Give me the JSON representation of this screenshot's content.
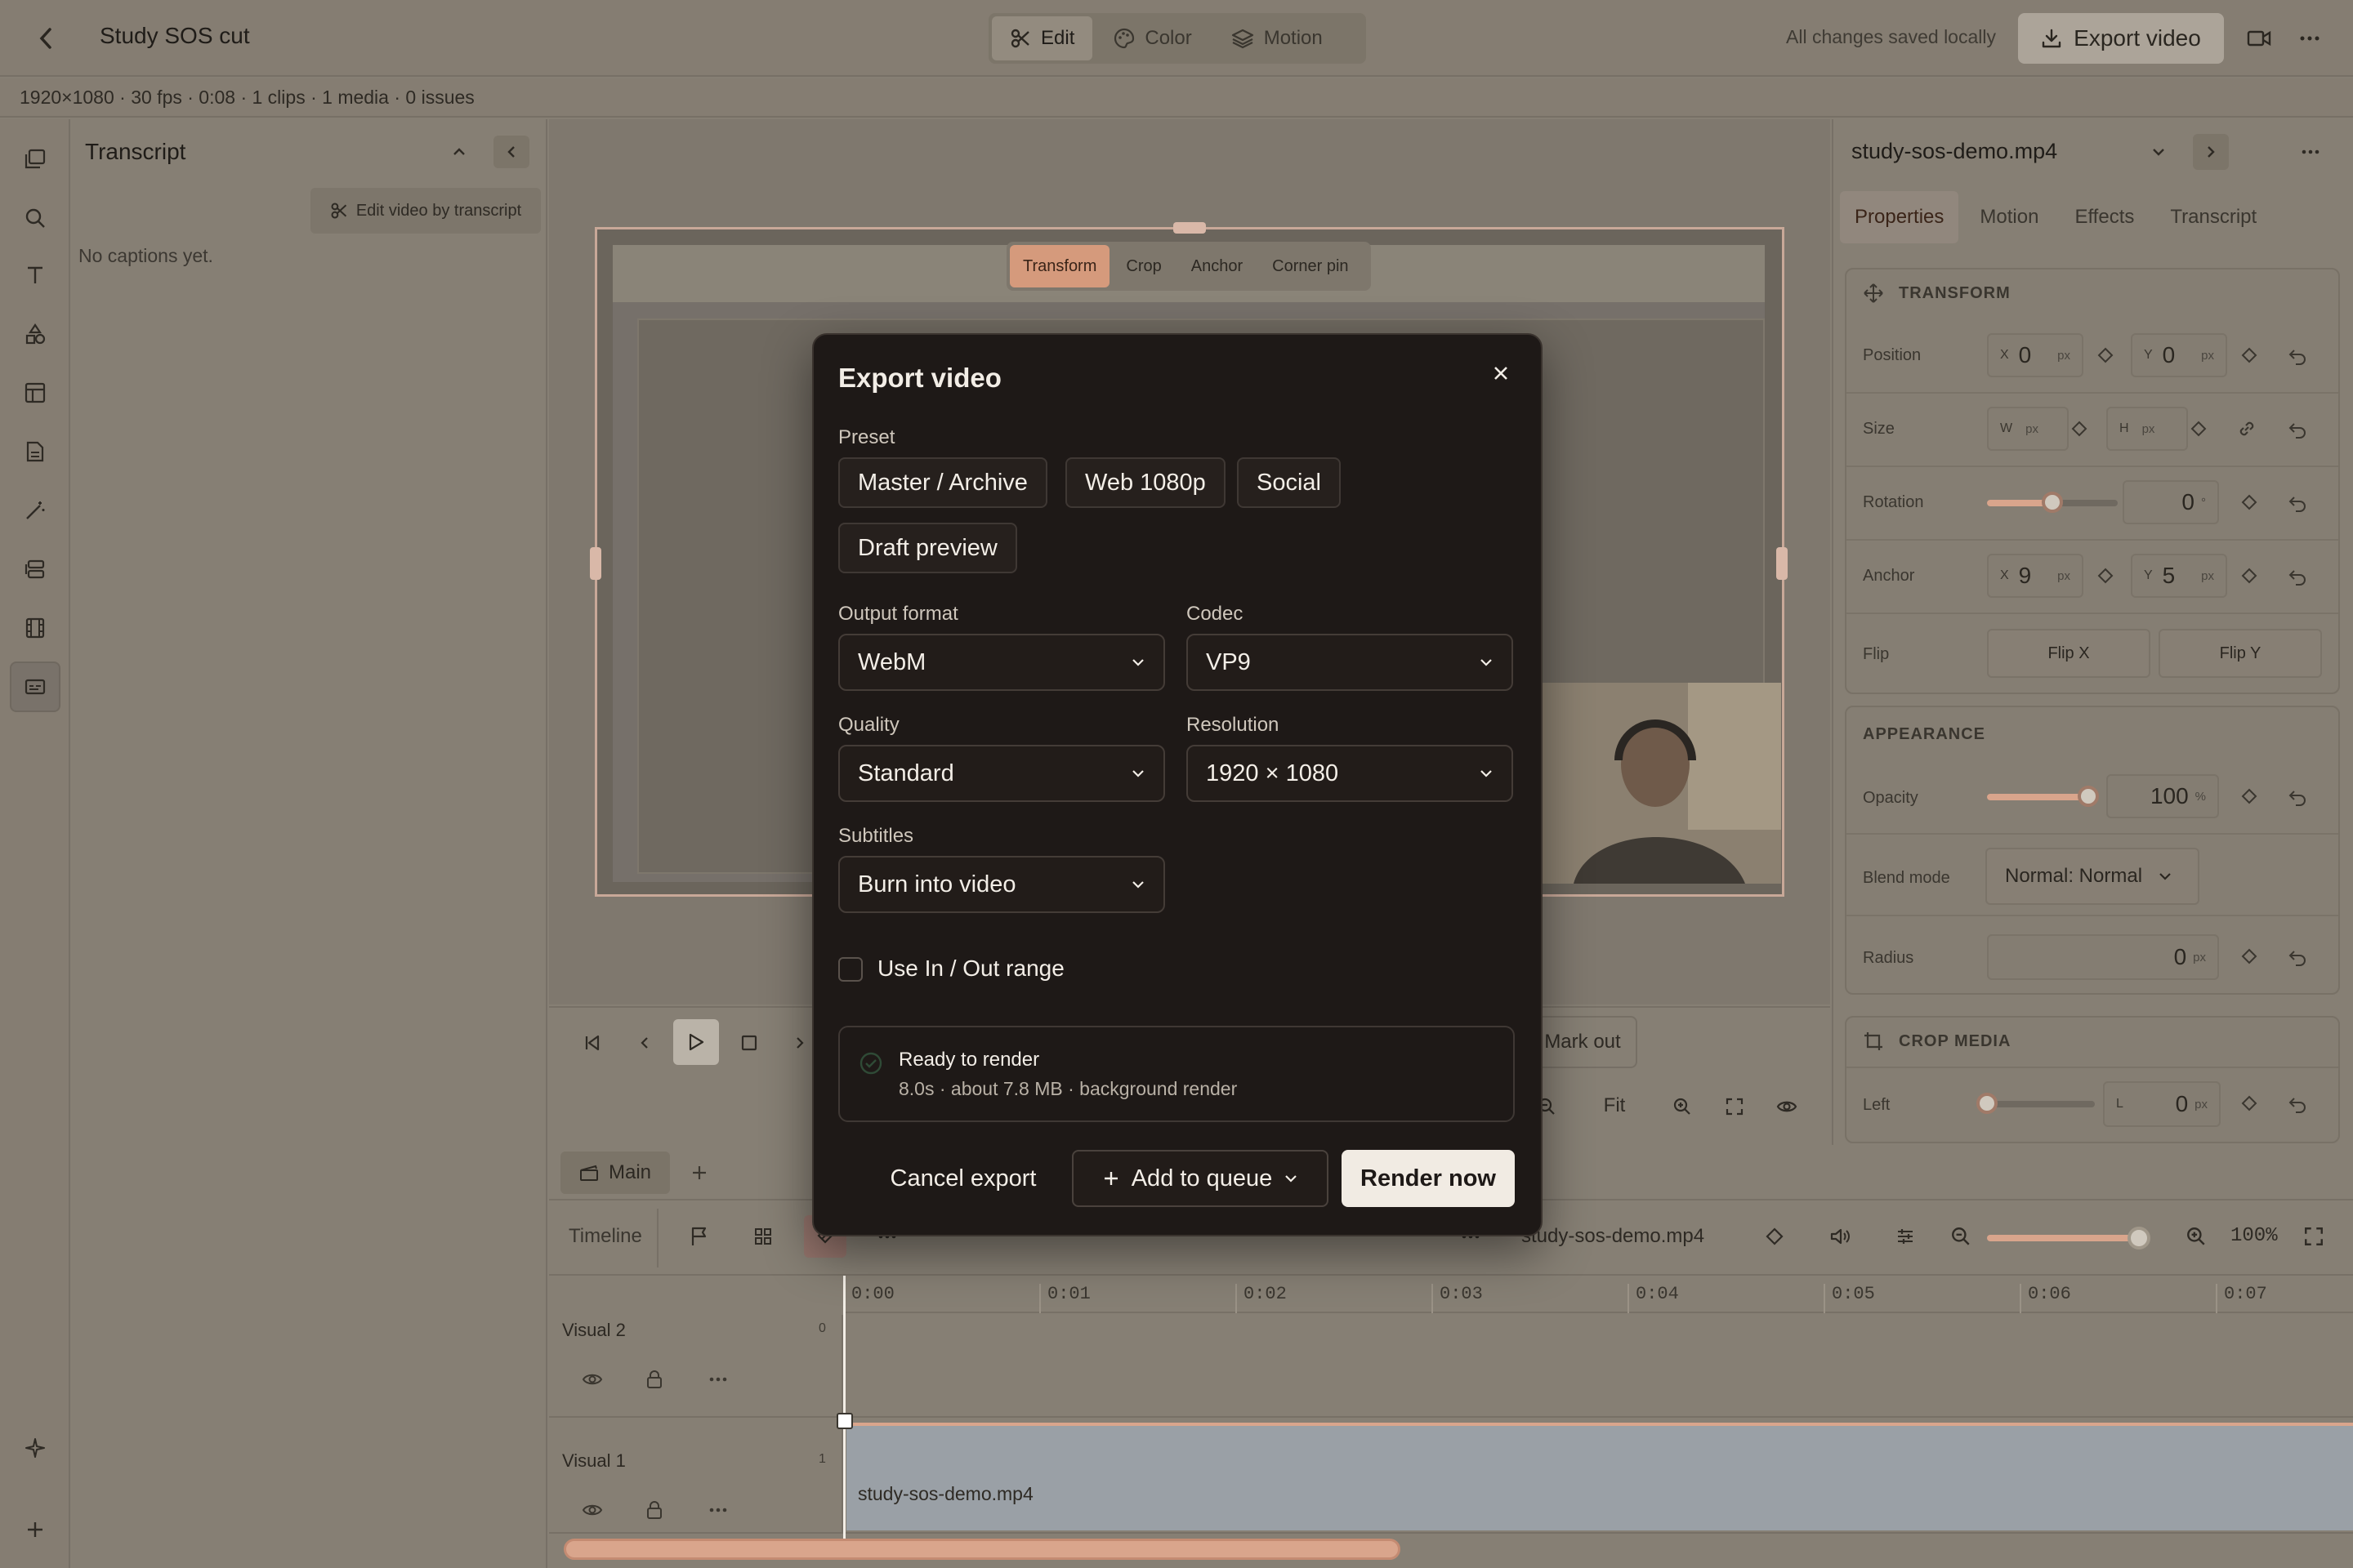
{
  "topbar": {
    "title": "Study SOS cut",
    "modes": [
      {
        "label": "Edit",
        "active": true
      },
      {
        "label": "Color",
        "active": false
      },
      {
        "label": "Motion",
        "active": false
      }
    ],
    "saved_status": "All changes saved locally",
    "export_label": "Export video"
  },
  "infobar": {
    "text": "1920×1080 · 30 fps · 0:08 · 1 clips · 1 media · 0 issues"
  },
  "transcript": {
    "title": "Transcript",
    "edit_button": "Edit video by transcript",
    "empty_text": "No captions yet."
  },
  "canvas": {
    "tools": [
      {
        "label": "Transform",
        "active": true
      },
      {
        "label": "Crop"
      },
      {
        "label": "Anchor"
      },
      {
        "label": "Corner pin"
      }
    ]
  },
  "transport": {
    "mark_out": "Mark out",
    "fit": "Fit"
  },
  "tabs": {
    "main": "Main"
  },
  "timeline": {
    "label": "Timeline",
    "clip_name": "study-sos-demo.mp4",
    "zoom": "100%",
    "ticks": [
      "0:00",
      "0:01",
      "0:02",
      "0:03",
      "0:04",
      "0:05",
      "0:06",
      "0:07"
    ],
    "tracks": [
      {
        "name": "Visual 2",
        "index": "0"
      },
      {
        "name": "Visual 1",
        "index": "1",
        "clip": "study-sos-demo.mp4"
      }
    ]
  },
  "inspector": {
    "file": "study-sos-demo.mp4",
    "tabs": [
      {
        "label": "Properties",
        "active": true
      },
      {
        "label": "Motion"
      },
      {
        "label": "Effects"
      },
      {
        "label": "Transcript"
      }
    ],
    "transform": {
      "heading": "TRANSFORM",
      "position_label": "Position",
      "pos_x": "0",
      "pos_y": "0",
      "size_label": "Size",
      "w_pre": "W",
      "h_pre": "H",
      "rotation_label": "Rotation",
      "rotation_value": "0",
      "rotation_unit": "°",
      "rotation_level": 0.5,
      "anchor_label": "Anchor",
      "anchor_x": "9",
      "anchor_y": "5",
      "flip_label": "Flip",
      "flip_x": "Flip X",
      "flip_y": "Flip Y",
      "unit": "px",
      "x_pre": "X",
      "y_pre": "Y"
    },
    "appearance": {
      "heading": "APPEARANCE",
      "opacity_label": "Opacity",
      "opacity_value": "100",
      "opacity_unit": "%",
      "opacity_level": 1.0,
      "blend_label": "Blend mode",
      "blend_value": "Normal: Normal",
      "radius_label": "Radius",
      "radius_value": "0"
    },
    "crop": {
      "heading": "CROP MEDIA",
      "left_label": "Left",
      "left_pre": "L",
      "left_value": "0",
      "left_level": 0.0
    }
  },
  "modal": {
    "title": "Export video",
    "preset_label": "Preset",
    "presets": [
      "Master / Archive",
      "Web 1080p",
      "Social",
      "Draft preview"
    ],
    "output_label": "Output format",
    "output_value": "WebM",
    "codec_label": "Codec",
    "codec_value": "VP9",
    "quality_label": "Quality",
    "quality_value": "Standard",
    "resolution_label": "Resolution",
    "resolution_value": "1920 × 1080",
    "subtitles_label": "Subtitles",
    "subtitles_value": "Burn into video",
    "range_label": "Use In / Out range",
    "range_checked": false,
    "status_title": "Ready to render",
    "status_sub": "8.0s · about 7.8 MB · background render",
    "cancel": "Cancel export",
    "queue": "Add to queue",
    "render": "Render now"
  },
  "colors": {
    "accent": "#d9a58c",
    "modal_bg": "#1e1917",
    "panel": "#867f74"
  }
}
